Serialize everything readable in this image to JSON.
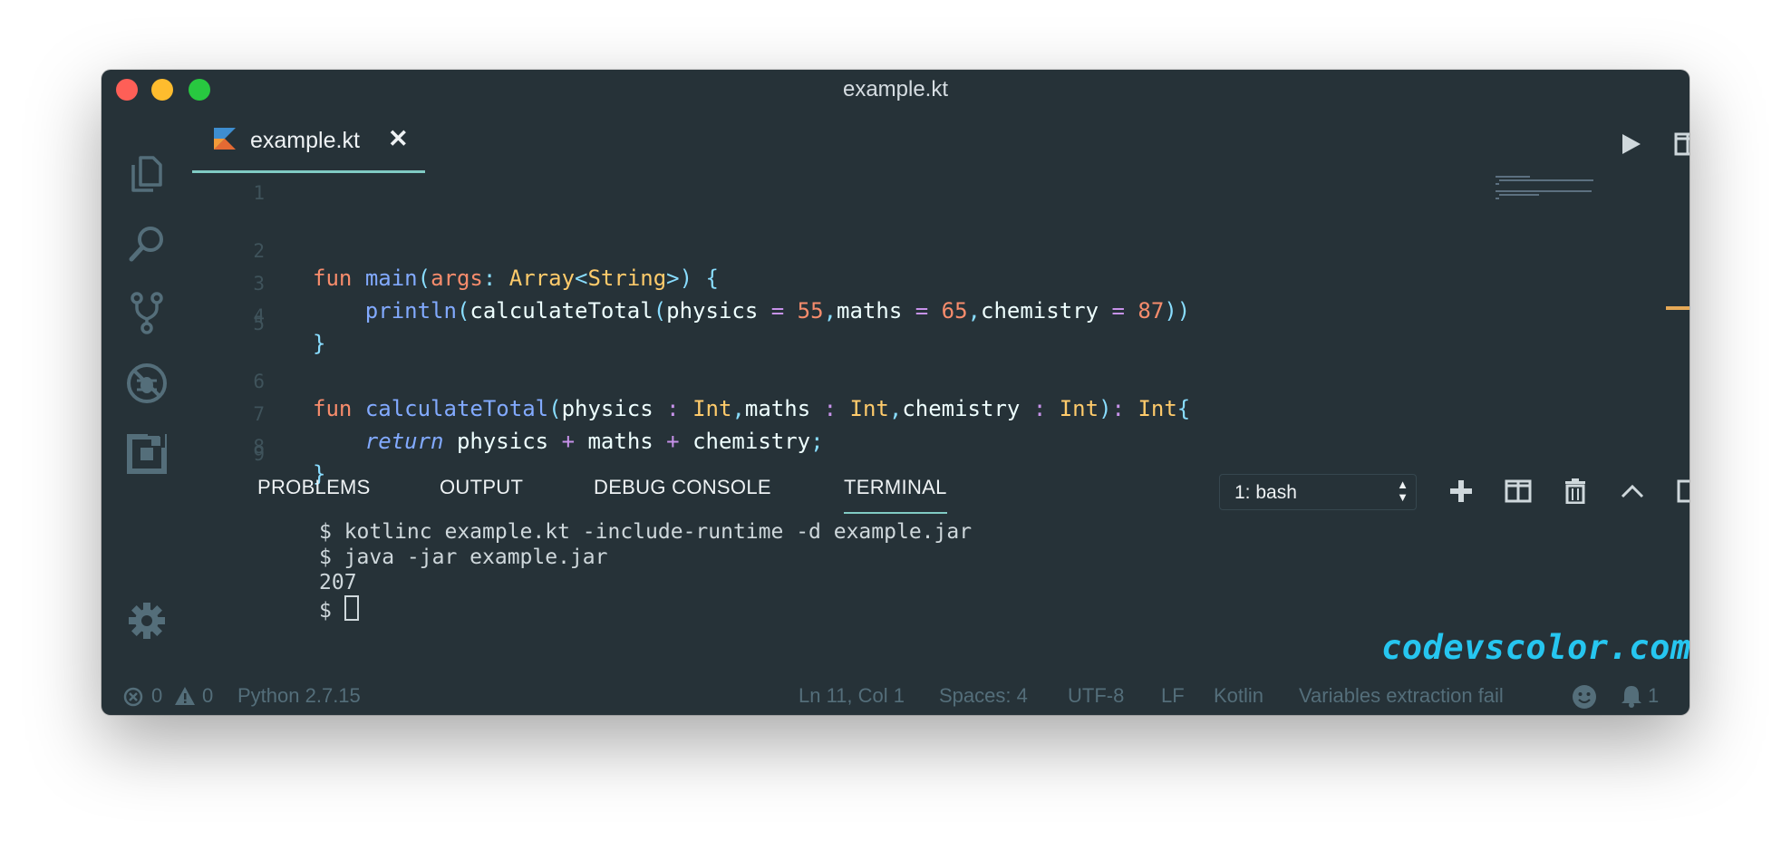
{
  "window": {
    "title": "example.kt"
  },
  "tab": {
    "label": "example.kt",
    "close": "✕"
  },
  "editor": {
    "lines": [
      {
        "n": "1"
      },
      {
        "n": "2"
      },
      {
        "n": "3"
      },
      {
        "n": "4"
      },
      {
        "n": "5"
      },
      {
        "n": "6"
      },
      {
        "n": "7"
      },
      {
        "n": "8"
      },
      {
        "n": "9"
      }
    ],
    "code": {
      "l2": [
        "fun",
        " ",
        "main",
        "(",
        "args",
        ":",
        " ",
        "Array",
        "<",
        "String",
        ">",
        ")",
        " ",
        "{"
      ],
      "l3": [
        "    ",
        "println",
        "(",
        "calculateTotal",
        "(",
        "physics",
        " ",
        "=",
        " ",
        "55",
        ",",
        "maths",
        " ",
        "=",
        " ",
        "65",
        ",",
        "chemistry",
        " ",
        "=",
        " ",
        "87",
        ")",
        ")"
      ],
      "l4": [
        "}"
      ],
      "l6": [
        "fun",
        " ",
        "calculateTotal",
        "(",
        "physics",
        " ",
        ":",
        " ",
        "Int",
        ",",
        "maths",
        " ",
        ":",
        " ",
        "Int",
        ",",
        "chemistry",
        " ",
        ":",
        " ",
        "Int",
        ")",
        ":",
        " ",
        "Int",
        "{"
      ],
      "l7": [
        "    ",
        "return",
        " ",
        "physics",
        " ",
        "+",
        " ",
        "maths",
        " ",
        "+",
        " ",
        "chemistry",
        ";"
      ],
      "l8": [
        "}"
      ]
    }
  },
  "panel": {
    "tabs": [
      "PROBLEMS",
      "OUTPUT",
      "DEBUG CONSOLE",
      "TERMINAL"
    ],
    "active_tab": "TERMINAL",
    "terminal_select": "1: bash",
    "terminal_lines": [
      "$ kotlinc example.kt -include-runtime -d example.jar",
      "$ java -jar example.jar",
      "207",
      "$ "
    ]
  },
  "watermark": "codevscolor.com",
  "status": {
    "errors": "0",
    "warnings": "0",
    "python": "Python 2.7.15",
    "position": "Ln 11, Col 1",
    "spaces": "Spaces: 4",
    "encoding": "UTF-8",
    "eol": "LF",
    "language": "Kotlin",
    "message": "Variables extraction fail",
    "notifications": "1"
  },
  "colors": {
    "background": "#263238",
    "accent": "#80cbc4",
    "keyword": "#f78c6c",
    "function": "#82aaff",
    "type": "#ffcb6b",
    "punctuation": "#89ddff",
    "operator": "#c792ea",
    "watermark": "#26c6f0"
  },
  "icons": {
    "activity": [
      "files-icon",
      "search-icon",
      "source-control-icon",
      "debug-icon",
      "extensions-icon",
      "gear-icon"
    ],
    "editor_actions": [
      "run-icon",
      "split-editor-icon",
      "more-icon"
    ],
    "panel_actions": [
      "new-terminal-icon",
      "split-terminal-icon",
      "kill-terminal-icon",
      "maximize-panel-icon",
      "toggle-panel-icon",
      "close-panel-icon"
    ]
  }
}
